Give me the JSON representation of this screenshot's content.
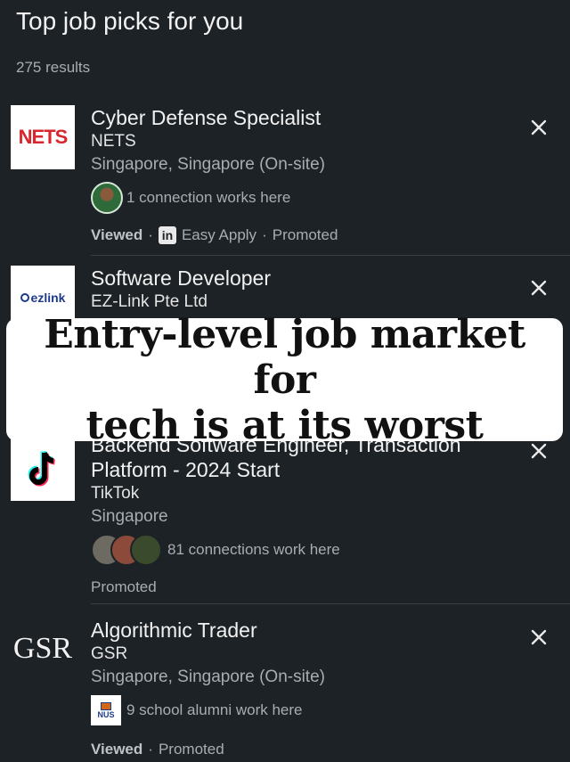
{
  "header": {
    "title": "Top job picks for you",
    "results": "275 results"
  },
  "jobs": [
    {
      "title": "Cyber Defense Specialist",
      "company": "NETS",
      "location": "Singapore, Singapore (On-site)",
      "insight": "1 connection works here",
      "viewed": "Viewed",
      "easy_apply": "Easy Apply",
      "promoted": "Promoted",
      "logo_text": "NETS",
      "logo_color": "#d8262e"
    },
    {
      "title": "Software Developer",
      "company": "EZ-Link Pte Ltd",
      "logo_text": "ezlink",
      "logo_color": "#1e3a8a"
    },
    {
      "title_partial": "Backend Software Engineer, Transaction",
      "title_line2": "Platform - 2024 Start",
      "company": "TikTok",
      "location": "Singapore",
      "insight": "81 connections work here",
      "promoted": "Promoted"
    },
    {
      "title": "Algorithmic Trader",
      "company": "GSR",
      "location": "Singapore, Singapore (On-site)",
      "insight": "9 school alumni work here",
      "viewed": "Viewed",
      "promoted": "Promoted",
      "logo_text": "GSR",
      "school_logo_text": "NUS"
    }
  ],
  "banner": {
    "line1": "Entry-level job market for",
    "line2": "tech is at its worst"
  },
  "icons": {
    "dismiss": "close-icon",
    "linkedin": "in"
  },
  "colors": {
    "background": "#1d2226",
    "muted_text": "#a9adb1",
    "nets_red": "#d8262e"
  }
}
